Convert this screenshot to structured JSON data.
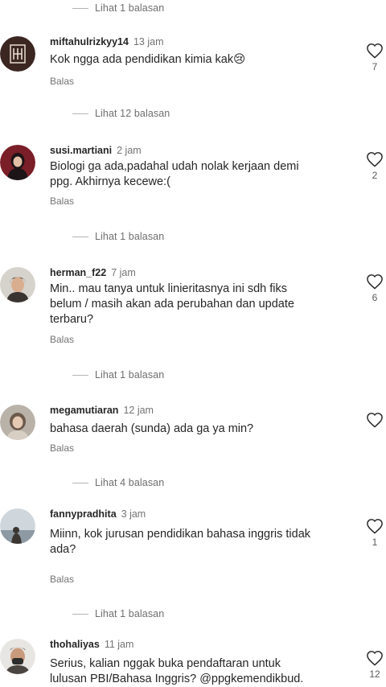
{
  "comments": [
    {
      "username": "miftahulrizkyy14",
      "time": "13 jam",
      "text": "Kok ngga ada pendidikan kimia kak😢",
      "reply_label": "Balas",
      "likes": "7",
      "view_replies": "Lihat 12 balasan"
    },
    {
      "username": "susi.martiani",
      "time": "2 jam",
      "text": "Biologi ga ada,padahal udah nolak kerjaan demi\nppg. Akhirnya kecewe:(",
      "reply_label": "Balas",
      "likes": "2",
      "view_replies": "Lihat 1 balasan"
    },
    {
      "username": "herman_f22",
      "time": "7 jam",
      "text": "Min.. mau tanya untuk linieritasnya ini sdh fiks\nbelum / masih akan ada perubahan dan update\nterbaru?",
      "reply_label": "Balas",
      "likes": "6",
      "view_replies": "Lihat 1 balasan"
    },
    {
      "username": "megamutiaran",
      "time": "12 jam",
      "text": "bahasa daerah (sunda) ada ga ya min?",
      "reply_label": "Balas",
      "likes": "",
      "view_replies": "Lihat 4 balasan"
    },
    {
      "username": "fannypradhita",
      "time": "3 jam",
      "text": "Miinn, kok jurusan pendidikan bahasa inggris tidak\nada?",
      "reply_label": "Balas",
      "likes": "1",
      "view_replies": "Lihat 1 balasan"
    },
    {
      "username": "thohaliyas",
      "time": "11 jam",
      "text": "Serius, kalian nggak buka pendaftaran untuk\nlulusan PBI/Bahasa Inggris? @ppgkemendikbud.",
      "reply_label": "",
      "likes": "12",
      "view_replies": ""
    }
  ],
  "top_view_replies": "Lihat 1 balasan",
  "icons": {
    "like": "heart-outline-icon"
  },
  "colors": {
    "text": "#262626",
    "muted": "#737373",
    "divider": "#b5b5b5"
  }
}
